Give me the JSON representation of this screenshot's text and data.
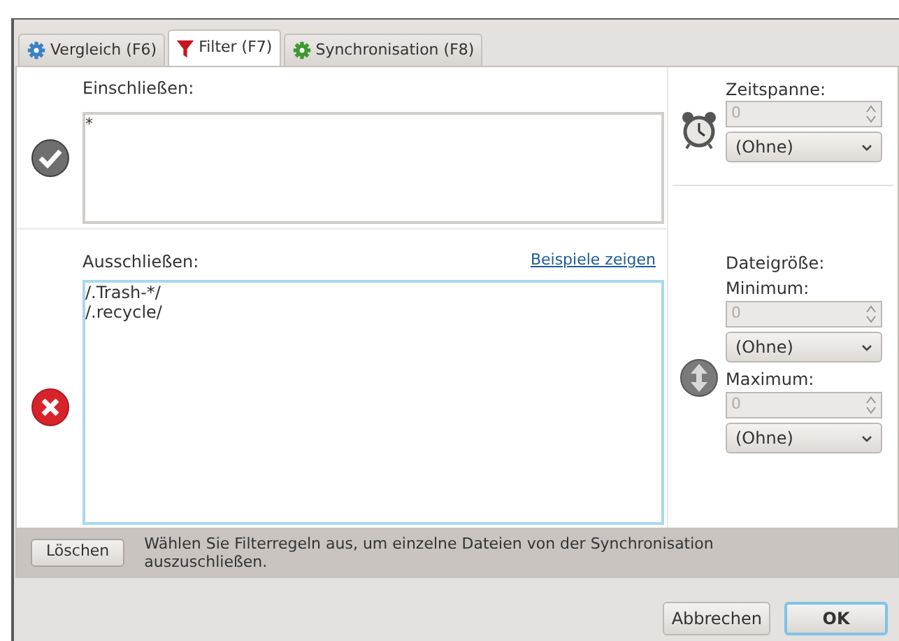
{
  "tabs": [
    {
      "label": "Vergleich (F6)",
      "kind": "gear-blue",
      "selected": false
    },
    {
      "label": "Filter (F7)",
      "kind": "funnel",
      "selected": true
    },
    {
      "label": "Synchronisation (F8)",
      "kind": "gear-green",
      "selected": false
    }
  ],
  "include": {
    "label": "Einschließen:",
    "value": "*"
  },
  "exclude": {
    "label": "Ausschließen:",
    "link": "Beispiele zeigen",
    "value": "/.Trash-*/\n/.recycle/",
    "focused": true
  },
  "timespan": {
    "label": "Zeitspanne:",
    "spin": {
      "value": "0",
      "disabled": true
    },
    "select": "(Ohne)"
  },
  "filesize": {
    "label": "Dateigröße:",
    "minimum": {
      "label": "Minimum:",
      "spin": {
        "value": "0",
        "disabled": true
      },
      "select": "(Ohne)"
    },
    "maximum": {
      "label": "Maximum:",
      "spin": {
        "value": "0",
        "disabled": true
      },
      "select": "(Ohne)"
    }
  },
  "bottom": {
    "button": "Löschen",
    "hint": "Wählen Sie Filterregeln aus, um einzelne Dateien von der Synchronisation auszuschließen."
  },
  "buttons": [
    {
      "label": "Abbrechen",
      "default": false
    },
    {
      "label": "OK",
      "default": true
    }
  ]
}
